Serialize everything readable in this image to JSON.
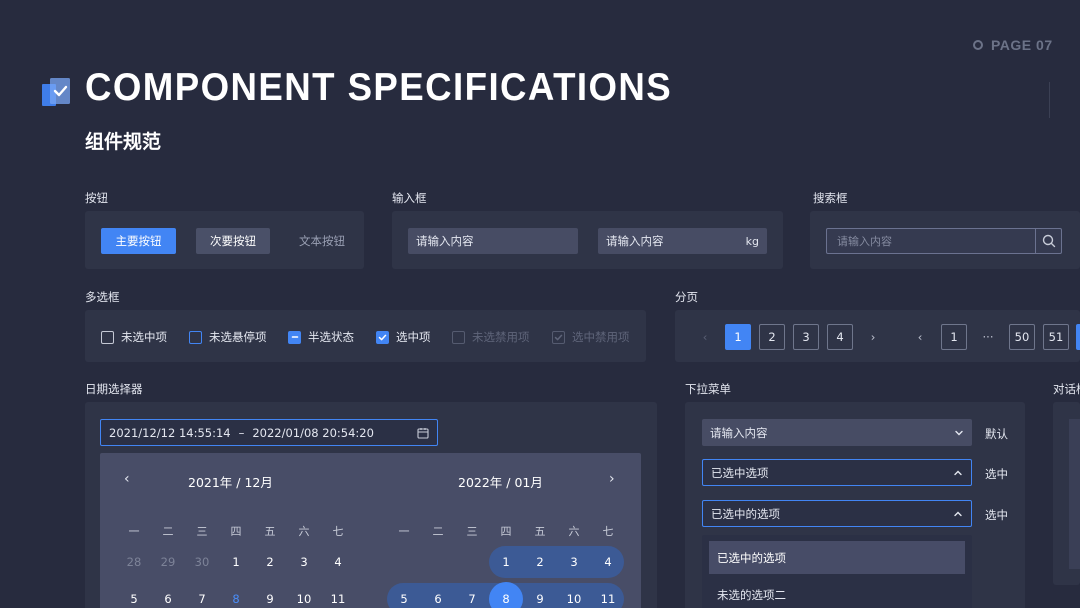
{
  "header": {
    "title": "COMPONENT SPECIFICATIONS",
    "subtitle": "组件规范",
    "page_indicator": "PAGE 07"
  },
  "buttons_section": {
    "label": "按钮",
    "primary": "主要按钮",
    "secondary": "次要按钮",
    "text": "文本按钮"
  },
  "input_section": {
    "label": "输入框",
    "input1_placeholder": "请输入内容",
    "input2_placeholder": "请输入内容",
    "input2_unit": "kg"
  },
  "search_section": {
    "label": "搜索框",
    "placeholder": "请输入内容"
  },
  "checkbox_section": {
    "label": "多选框",
    "items": [
      {
        "label": "未选中项",
        "state": "unchecked"
      },
      {
        "label": "未选悬停项",
        "state": "hover"
      },
      {
        "label": "半选状态",
        "state": "indeterminate"
      },
      {
        "label": "选中项",
        "state": "checked"
      },
      {
        "label": "未选禁用项",
        "state": "disabled"
      },
      {
        "label": "选中禁用项",
        "state": "checked-disabled"
      }
    ]
  },
  "pagination_section": {
    "label": "分页",
    "group1": [
      "1",
      "2",
      "3",
      "4"
    ],
    "group1_active": "1",
    "group2_first": "1",
    "ellipsis": "···",
    "group2_last": [
      "50",
      "51"
    ]
  },
  "date_section": {
    "label": "日期选择器",
    "start": "2021/12/12 14:55:14",
    "separator": "–",
    "end": "2022/01/08 20:54:20",
    "left_month": "2021年 / 12月",
    "right_month": "2022年 / 01月",
    "weekdays": [
      "一",
      "二",
      "三",
      "四",
      "五",
      "六",
      "七"
    ],
    "left_row1": [
      "28",
      "29",
      "30",
      "1",
      "2",
      "3",
      "4"
    ],
    "left_row2": [
      "5",
      "6",
      "7",
      "8",
      "9",
      "10",
      "11"
    ],
    "right_row1": [
      "1",
      "2",
      "3",
      "4"
    ],
    "right_row2": [
      "5",
      "6",
      "7",
      "8",
      "9",
      "10",
      "11"
    ]
  },
  "dropdown_section": {
    "label": "下拉菜单",
    "default_value": "请输入内容",
    "default_note": "默认",
    "selected_value": "已选中选项",
    "selected_note": "选中",
    "open_value": "已选中的选项",
    "open_note": "选中",
    "options": [
      "已选中的选项",
      "未选的选项二"
    ]
  },
  "dialog_section": {
    "label": "对话框"
  },
  "colors": {
    "background": "#272b3e",
    "panel": "#2f3447",
    "accent": "#4285f4"
  }
}
